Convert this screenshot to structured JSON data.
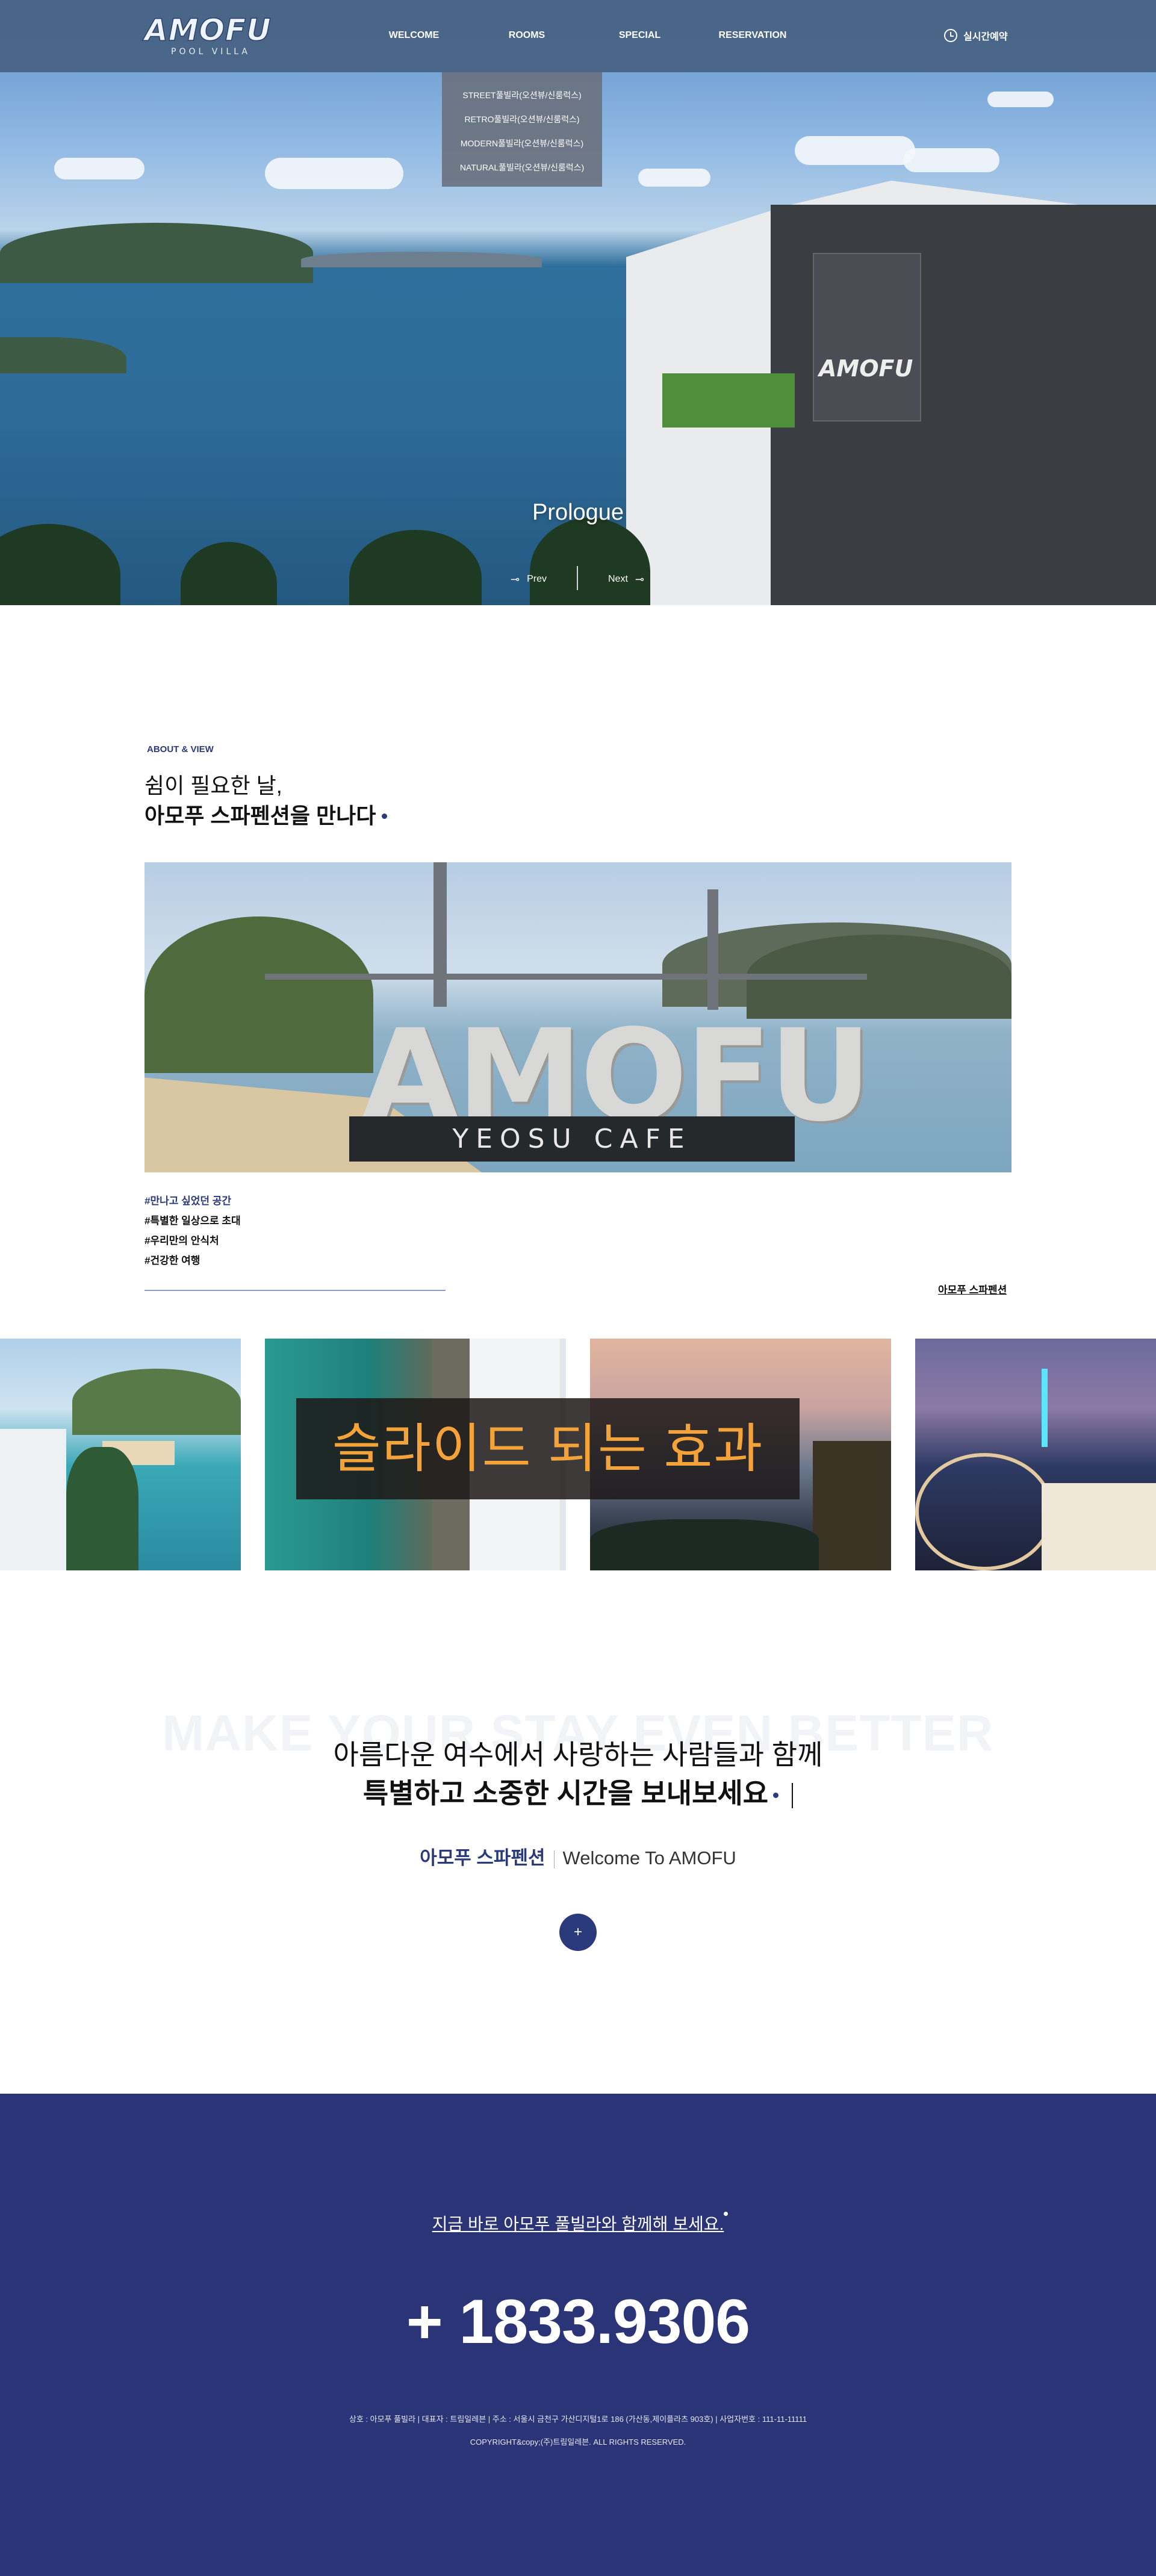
{
  "header": {
    "logo_main": "AMOFU",
    "logo_sub": "POOL VILLA",
    "nav": [
      "WELCOME",
      "ROOMS",
      "SPECIAL",
      "RESERVATION"
    ],
    "rooms_dropdown": [
      "STREET풀빌라(오션뷰/신룸럭스)",
      "RETRO풀빌라(오션뷰/신룸럭스)",
      "MODERN풀빌라(오션뷰/신룸럭스)",
      "NATURAL풀빌라(오션뷰/신룸럭스)"
    ],
    "realtime_label": "실시간예약"
  },
  "hero": {
    "sign_text": "AMOFU",
    "title": "Prologue",
    "prev_label": "Prev",
    "next_label": "Next"
  },
  "about": {
    "eyebrow": "ABOUT & VIEW",
    "line1": "쉼이 필요한 날,",
    "line2": "아모푸 스파펜션을 만나다",
    "photo_sign": "AMOFU",
    "photo_board": "YEOSU CAFE",
    "tags": [
      "#만나고 싶었던 공간",
      "#특별한 일상으로 초대",
      "#우리만의 안식처",
      "#건강한 여행"
    ],
    "link": "아모푸 스파펜션"
  },
  "gallery": {
    "banner": "슬라이드 되는 효과"
  },
  "stay": {
    "bg_text": "MAKE YOUR STAY EVEN BETTER",
    "line1": "아름다운 여수에서 사랑하는 사람들과 함께",
    "line2": "특별하고 소중한 시간을 보내보세요",
    "brand": "아모푸 스파펜션",
    "welcome": "Welcome To AMOFU",
    "plus": "+"
  },
  "footer": {
    "cta": "지금 바로 아모푸 풀빌라와 함께해 보세요.",
    "phone": "+ 1833.9306",
    "info": "상호 : 아모푸 풀빌라  |  대표자 : 트림일레븐  |  주소 : 서울시 금천구 가산디지털1로 186 (가산동,제이플라츠 903호)  |  사업자번호 : 111-11-11111",
    "copyright": "COPYRIGHT&copy;(주)트림일레븐. ALL RIGHTS RESERVED."
  },
  "colors": {
    "brand_navy": "#2b3a7b",
    "footer_bg": "#2b3476",
    "banner_text": "#f4a23a"
  }
}
